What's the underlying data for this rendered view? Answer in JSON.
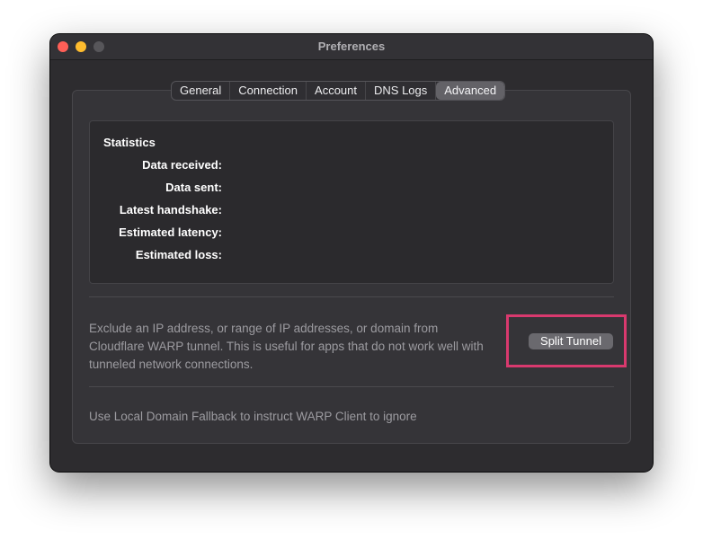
{
  "window": {
    "title": "Preferences"
  },
  "tabs": [
    {
      "label": "General",
      "selected": false
    },
    {
      "label": "Connection",
      "selected": false
    },
    {
      "label": "Account",
      "selected": false
    },
    {
      "label": "DNS Logs",
      "selected": false
    },
    {
      "label": "Advanced",
      "selected": true
    }
  ],
  "statistics": {
    "heading": "Statistics",
    "rows": [
      {
        "label": "Data received:",
        "value": ""
      },
      {
        "label": "Data sent:",
        "value": ""
      },
      {
        "label": "Latest handshake:",
        "value": ""
      },
      {
        "label": "Estimated latency:",
        "value": ""
      },
      {
        "label": "Estimated loss:",
        "value": ""
      }
    ]
  },
  "split_tunnel": {
    "description": "Exclude an IP address, or range of IP addresses, or domain from Cloudflare WARP tunnel. This is useful for apps that do not work well with tunneled network connections.",
    "button_label": "Split Tunnel"
  },
  "local_domain_fallback": {
    "description": "Use Local Domain Fallback to instruct WARP Client to ignore"
  },
  "colors": {
    "window_bg": "#2d2c2f",
    "panel_bg": "#353438",
    "highlight": "#d9396e",
    "close": "#ff5f57",
    "minimize": "#febc2e",
    "zoom_disabled": "#57565a"
  },
  "icons": [
    "close-window-icon",
    "minimize-window-icon",
    "zoom-window-icon"
  ]
}
